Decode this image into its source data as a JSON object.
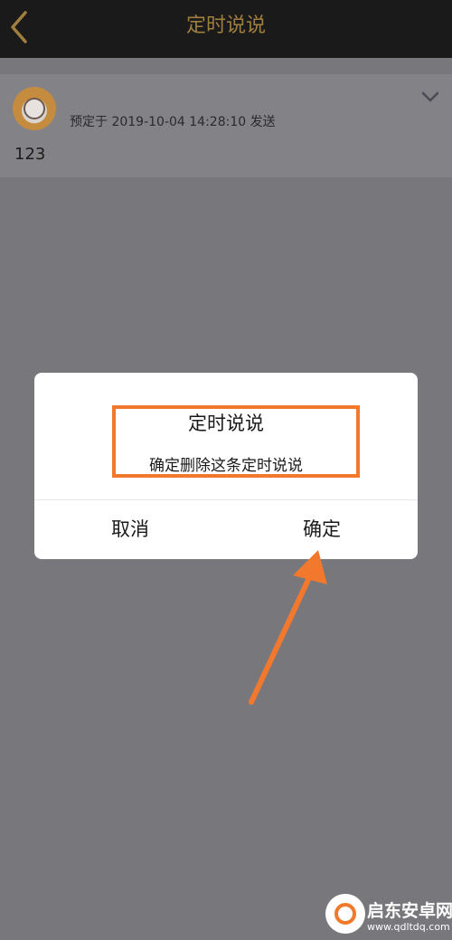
{
  "header": {
    "title": "定时说说",
    "back_icon": "chevron-left-icon"
  },
  "post": {
    "schedule_text": "预定于 2019-10-04 14:28:10 发送",
    "content": "123",
    "expand_icon": "chevron-down-icon"
  },
  "dialog": {
    "title": "定时说说",
    "message": "确定删除这条定时说说",
    "cancel_label": "取消",
    "confirm_label": "确定"
  },
  "colors": {
    "topbar": "#1a1a1a",
    "title_gold": "#a07f3e",
    "overlay": "#78787c",
    "annotation_orange": "#f2782e"
  },
  "watermark": {
    "name": "启东安卓网",
    "url": "www.qdltdq.com"
  }
}
